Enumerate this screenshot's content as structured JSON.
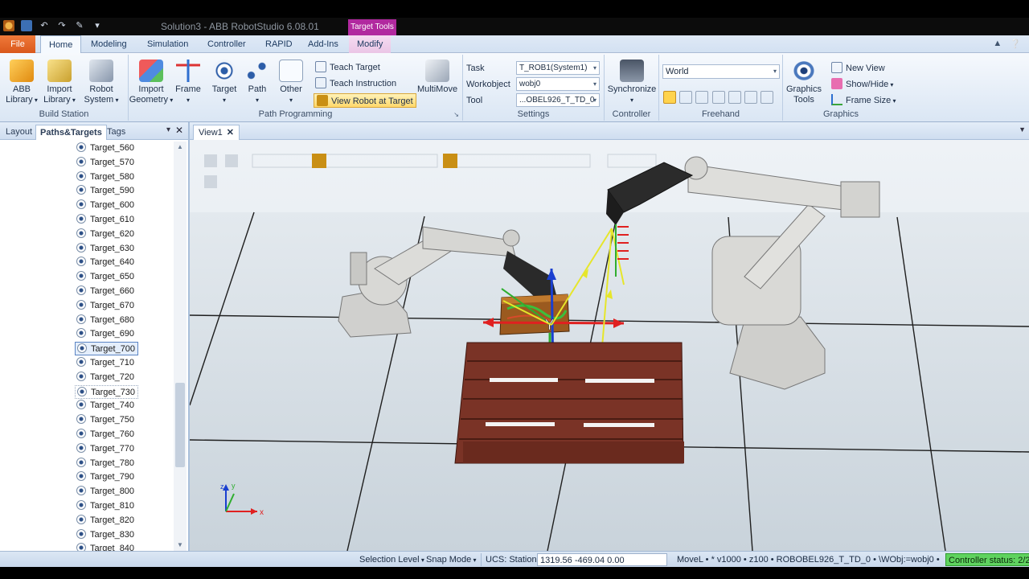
{
  "app": {
    "title": "Solution3 - ABB RobotStudio 6.08.01",
    "context_tab_group": "Target Tools",
    "qat_icons": [
      "app-logo-icon",
      "save-icon",
      "undo-icon",
      "redo-icon",
      "brush-icon",
      "customize-icon"
    ]
  },
  "menu": {
    "tabs": [
      "File",
      "Home",
      "Modeling",
      "Simulation",
      "Controller",
      "RAPID",
      "Add-Ins",
      "Modify"
    ],
    "active": "Home"
  },
  "ribbon": {
    "build_station": {
      "label": "Build Station",
      "abb_library": [
        "ABB",
        "Library"
      ],
      "import_library": [
        "Import",
        "Library"
      ],
      "robot_system": [
        "Robot",
        "System"
      ]
    },
    "path_programming": {
      "label": "Path Programming",
      "import_geometry": [
        "Import",
        "Geometry"
      ],
      "frame": "Frame",
      "target": "Target",
      "path": "Path",
      "other": "Other",
      "teach_target": "Teach Target",
      "teach_instruction": "Teach Instruction",
      "view_robot_at_target": "View Robot at Target",
      "multimove": "MultiMove"
    },
    "settings": {
      "label": "Settings",
      "task_label": "Task",
      "task_value": "T_ROB1(System1)",
      "workobject_label": "Workobject",
      "workobject_value": "wobj0",
      "tool_label": "Tool",
      "tool_value": "...OBEL926_T_TD_0"
    },
    "controller": {
      "label": "Controller",
      "synchronize": "Synchronize"
    },
    "freehand": {
      "label": "Freehand",
      "reference": "World"
    },
    "graphics": {
      "label": "Graphics",
      "graphics_tools": [
        "Graphics",
        "Tools"
      ],
      "new_view": "New View",
      "show_hide": "Show/Hide",
      "frame_size": "Frame Size"
    }
  },
  "left_panel": {
    "tabs": [
      "Layout",
      "Paths&Targets",
      "Tags"
    ],
    "active_tab": "Paths&Targets",
    "targets": [
      "Target_560",
      "Target_570",
      "Target_580",
      "Target_590",
      "Target_600",
      "Target_610",
      "Target_620",
      "Target_630",
      "Target_640",
      "Target_650",
      "Target_660",
      "Target_670",
      "Target_680",
      "Target_690",
      "Target_700",
      "Target_710",
      "Target_720",
      "Target_730",
      "Target_740",
      "Target_750",
      "Target_760",
      "Target_770",
      "Target_780",
      "Target_790",
      "Target_800",
      "Target_810",
      "Target_820",
      "Target_830",
      "Target_840"
    ],
    "selected": "Target_700",
    "hovered": "Target_730"
  },
  "view": {
    "tab": "View1",
    "axis_x": "x",
    "axis_y": "y",
    "axis_z": "z"
  },
  "status": {
    "selection_level": "Selection Level",
    "snap_mode": "Snap Mode",
    "ucs": "UCS: Station",
    "coords": "1319.56  -469.04  0.00",
    "instruction": "MoveL  •  *  v1000  •  z100  •  ROBOBEL926_T_TD_0  •  \\WObj:=wobj0  •",
    "controller_status": "Controller status: 2/2"
  },
  "colors": {
    "accent_file": "#e8692a",
    "context_tab": "#b1299f",
    "controller_ok": "#5fd35f",
    "floor": "#d4dde4",
    "pallet": "#7a3326",
    "robot": "#d8d8d6"
  }
}
